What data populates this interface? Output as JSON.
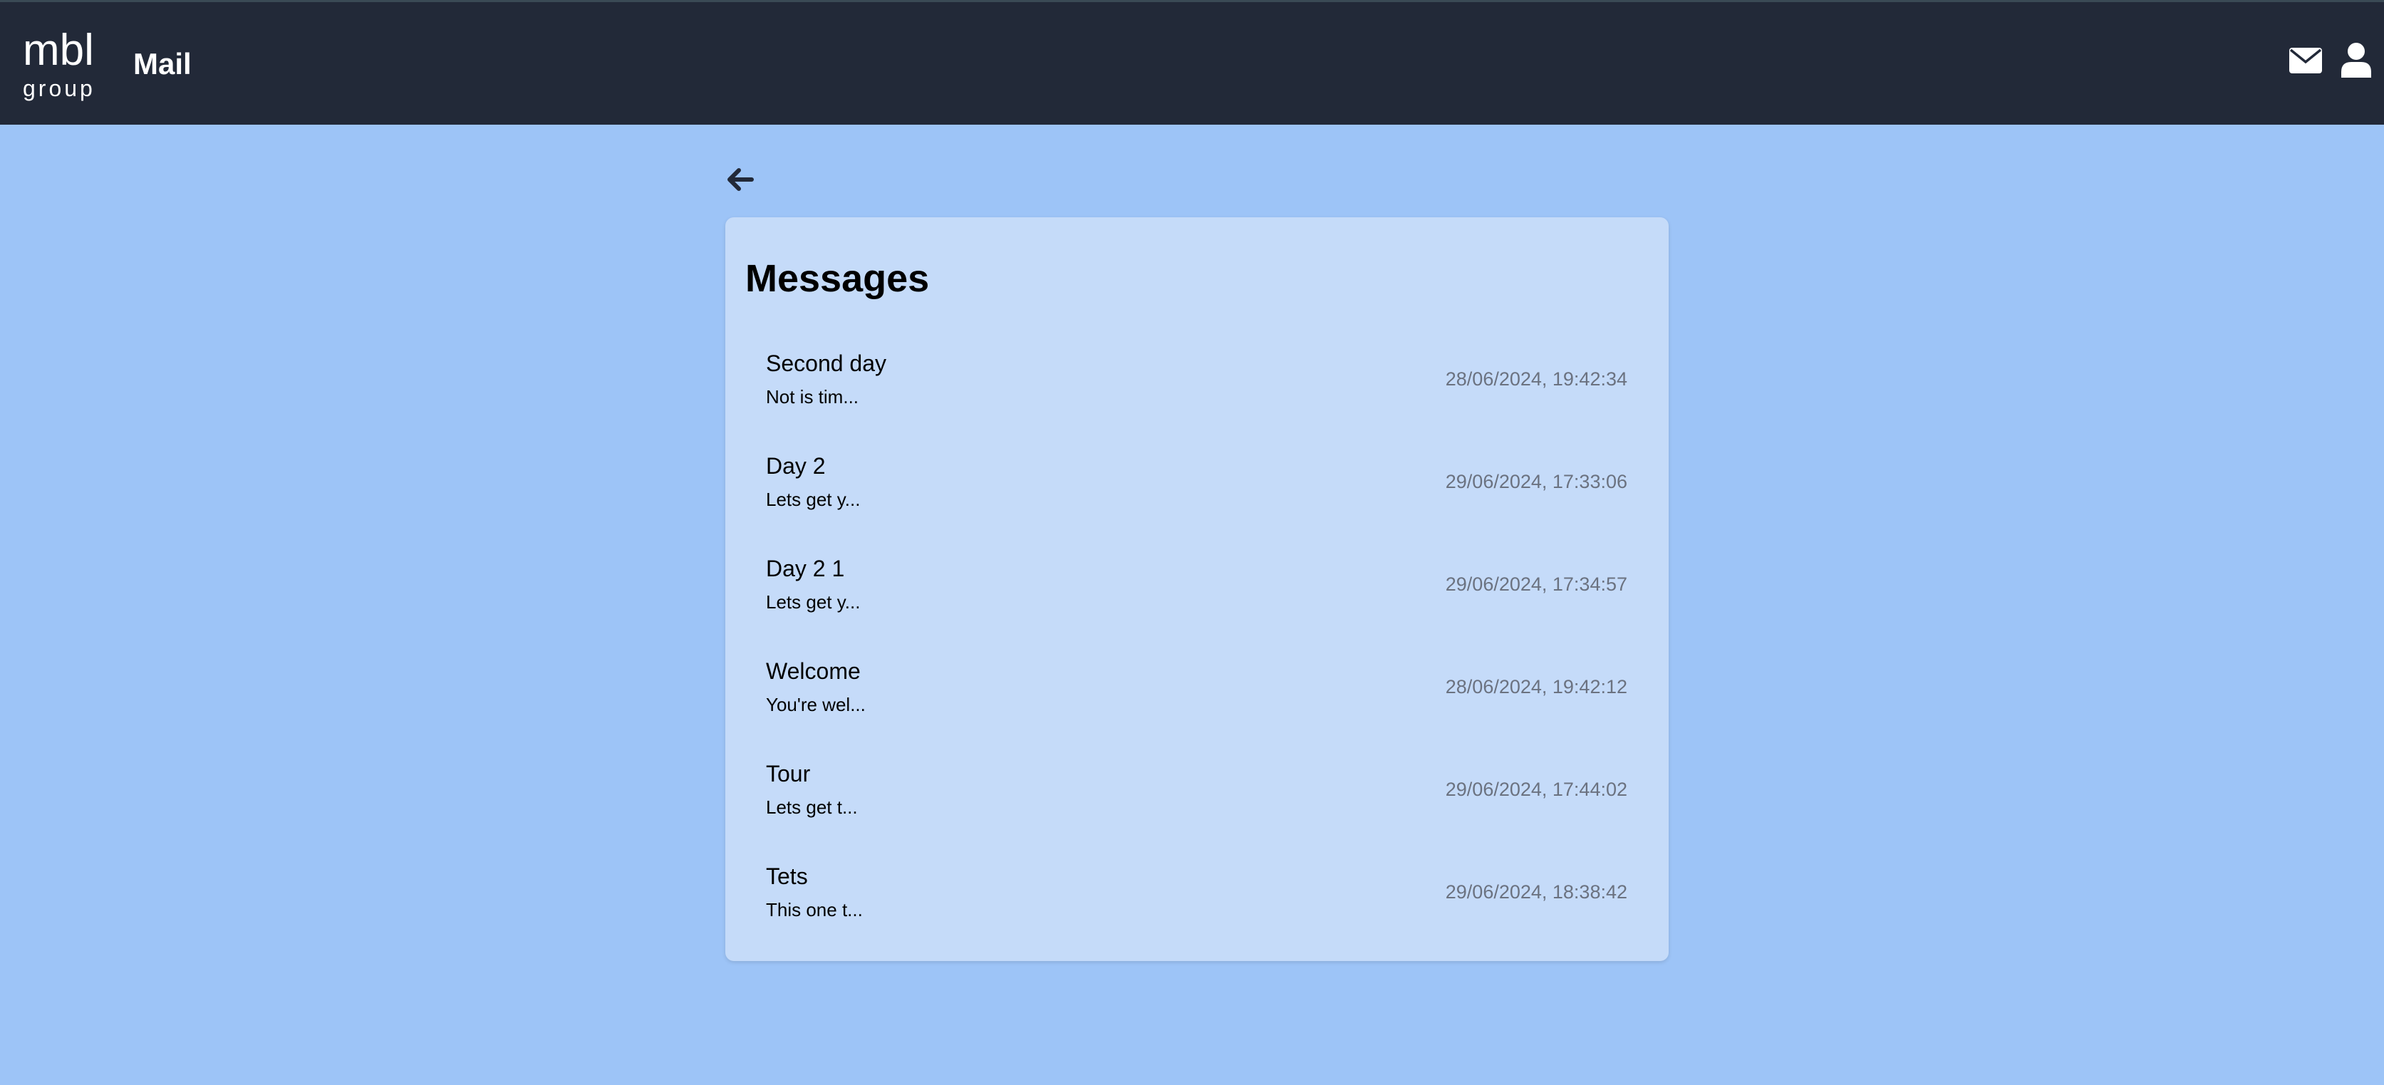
{
  "header": {
    "logo_text_top": "mbl",
    "logo_text_bottom": "group",
    "title": "Mail",
    "icons": [
      "mail-icon",
      "user-icon"
    ],
    "background": "#222938"
  },
  "nav": {
    "back_icon": "arrow-left-icon"
  },
  "main": {
    "title": "Messages",
    "messages": [
      {
        "subject": "Second day",
        "preview": "Not is tim...",
        "date": "28/06/2024, 19:42:34"
      },
      {
        "subject": "Day 2",
        "preview": "Lets get y...",
        "date": "29/06/2024, 17:33:06"
      },
      {
        "subject": "Day 2 1",
        "preview": "Lets get y...",
        "date": "29/06/2024, 17:34:57"
      },
      {
        "subject": "Welcome",
        "preview": "You're wel...",
        "date": "28/06/2024, 19:42:12"
      },
      {
        "subject": "Tour",
        "preview": "Lets get t...",
        "date": "29/06/2024, 17:44:02"
      },
      {
        "subject": "Tets",
        "preview": "This one t...",
        "date": "29/06/2024, 18:38:42"
      }
    ]
  },
  "colors": {
    "page_background": "#9dc4f7",
    "card_background": "#c5dbf9",
    "date_text": "#6b7280"
  }
}
